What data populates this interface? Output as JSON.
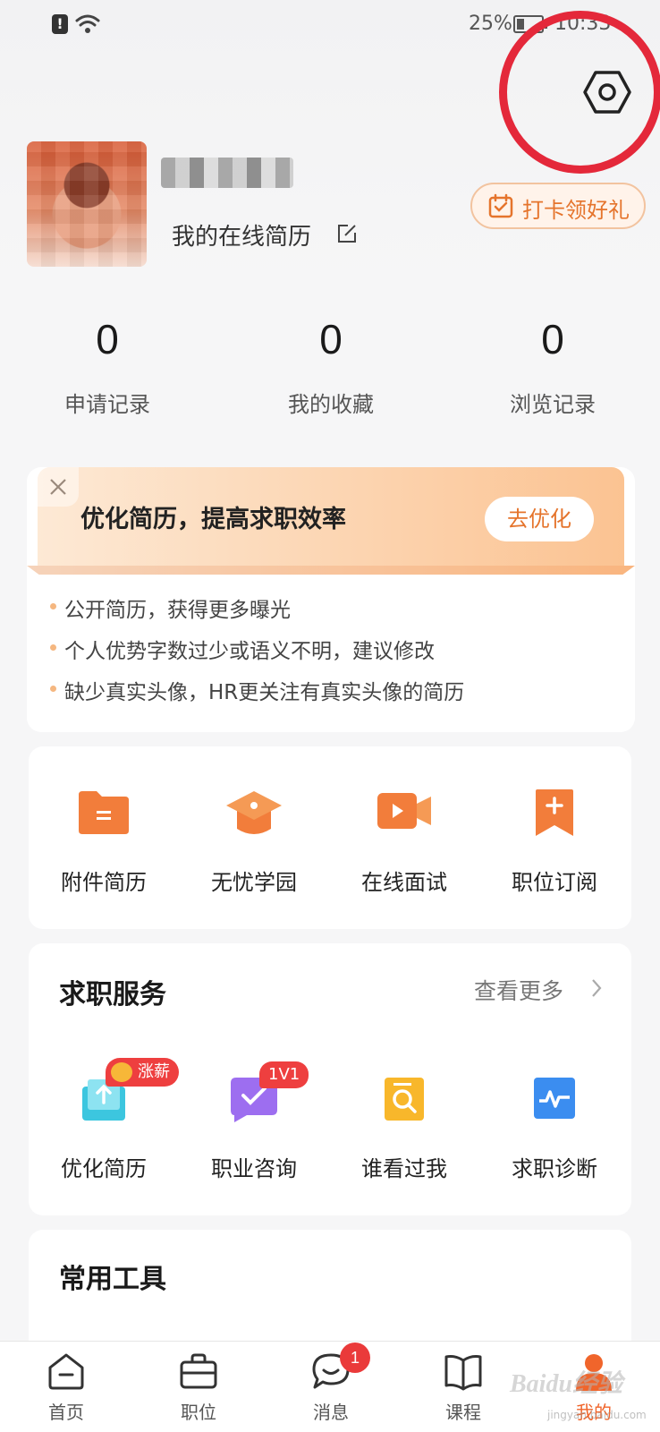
{
  "status_bar": {
    "battery_pct": "25%",
    "time": "10:33"
  },
  "profile": {
    "resume_link": "我的在线简历",
    "checkin_label": "打卡领好礼"
  },
  "stats": [
    {
      "value": "0",
      "label": "申请记录"
    },
    {
      "value": "0",
      "label": "我的收藏"
    },
    {
      "value": "0",
      "label": "浏览记录"
    }
  ],
  "optimize": {
    "title": "优化简历，提高求职效率",
    "button": "去优化",
    "items": [
      "公开简历，获得更多曝光",
      "个人优势字数过少或语义不明，建议修改",
      "缺少真实头像，HR更关注有真实头像的简历"
    ]
  },
  "quick_grid": [
    {
      "label": "附件简历",
      "icon": "folder-icon"
    },
    {
      "label": "无忧学园",
      "icon": "graduation-cap-icon"
    },
    {
      "label": "在线面试",
      "icon": "video-camera-icon"
    },
    {
      "label": "职位订阅",
      "icon": "bookmark-plus-icon"
    }
  ],
  "services": {
    "title": "求职服务",
    "see_more": "查看更多",
    "items": [
      {
        "label": "优化简历",
        "icon": "upload-resume-icon",
        "badge": "涨薪"
      },
      {
        "label": "职业咨询",
        "icon": "consult-chat-icon",
        "badge": "1V1"
      },
      {
        "label": "谁看过我",
        "icon": "search-document-icon"
      },
      {
        "label": "求职诊断",
        "icon": "diagnosis-chart-icon"
      }
    ]
  },
  "tools": {
    "title": "常用工具"
  },
  "bottom_nav": {
    "items": [
      {
        "label": "首页",
        "icon": "home-icon"
      },
      {
        "label": "职位",
        "icon": "briefcase-icon"
      },
      {
        "label": "消息",
        "icon": "message-icon",
        "badge": "1"
      },
      {
        "label": "课程",
        "icon": "book-icon"
      },
      {
        "label": "我的",
        "icon": "person-icon"
      }
    ],
    "active": "我的"
  },
  "watermark": {
    "text": "Baidu经验",
    "sub": "jingyan.baidu.com"
  },
  "colors": {
    "accent": "#f0652b",
    "highlight_ring": "#e4283a",
    "badge_red": "#ea3a3a"
  }
}
